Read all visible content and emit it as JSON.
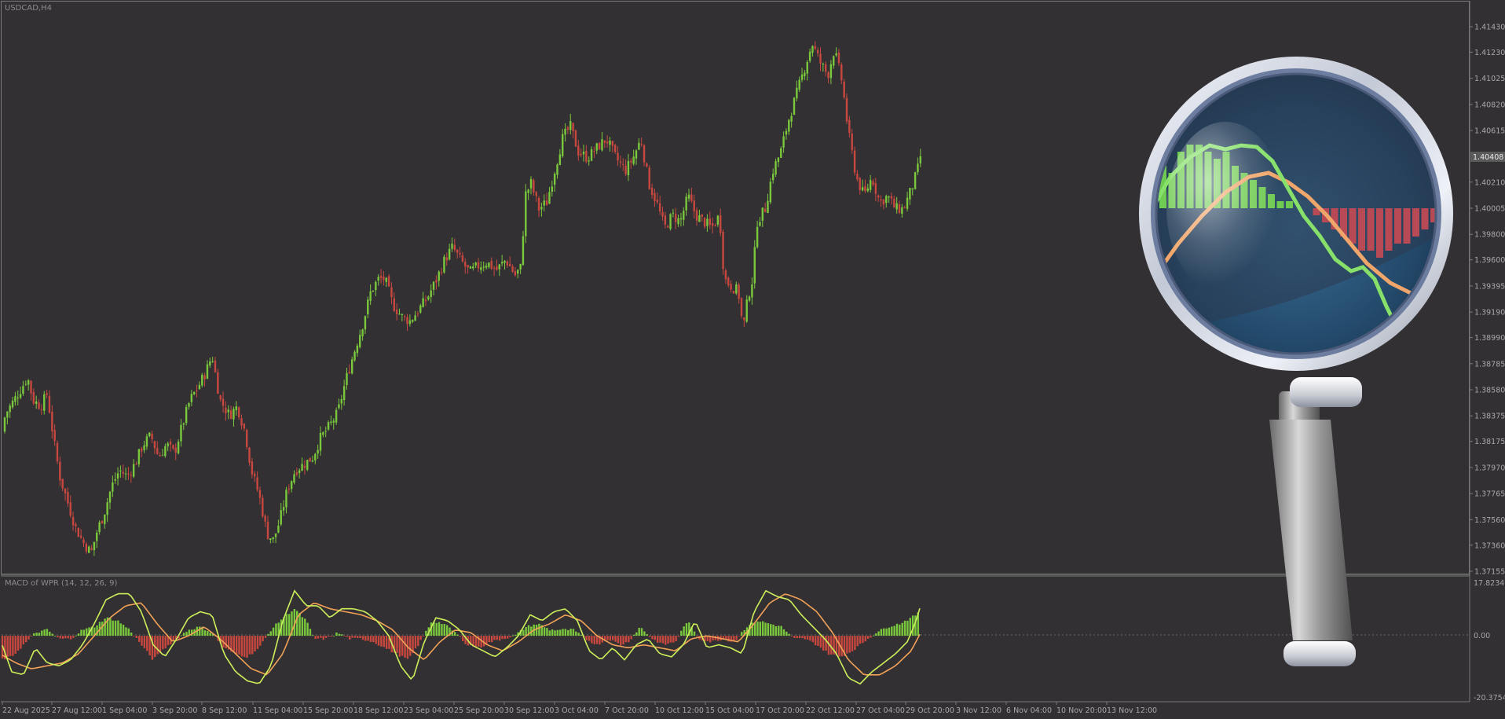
{
  "window": {
    "symbol_title": "USDCAD,H4",
    "indicator_title": "MACD of WPR (14, 12, 26, 9)"
  },
  "colors": {
    "background": "#333033",
    "bull": "#7ac93c",
    "bear": "#c8483f",
    "macd_line": "#cdf05a",
    "signal_line": "#f2a257",
    "grid": "#5c5c5c",
    "magnifier_lens": "#2d5878"
  },
  "price_axis": {
    "ticks": [
      "1.41430",
      "1.41230",
      "1.41025",
      "1.40820",
      "1.40615",
      "1.40210",
      "1.40005",
      "1.39800",
      "1.39600",
      "1.39395",
      "1.39190",
      "1.38990",
      "1.38785",
      "1.38580",
      "1.38375",
      "1.38175",
      "1.37970",
      "1.37765",
      "1.37560",
      "1.37360",
      "1.37155"
    ],
    "current_price": "1.40408",
    "ylim": [
      1.37155,
      1.4153
    ]
  },
  "indicator_axis": {
    "top": "17.8234",
    "zero": "0.00",
    "bottom": "-20.3754"
  },
  "time_axis": {
    "labels": [
      "22 Aug 2025",
      "27 Aug 12:00",
      "1 Sep 04:00",
      "3 Sep 20:00",
      "8 Sep 12:00",
      "11 Sep 04:00",
      "15 Sep 20:00",
      "18 Sep 12:00",
      "23 Sep 04:00",
      "25 Sep 20:00",
      "30 Sep 12:00",
      "3 Oct 04:00",
      "7 Oct 20:00",
      "10 Oct 12:00",
      "15 Oct 04:00",
      "17 Oct 20:00",
      "22 Oct 12:00",
      "27 Oct 04:00",
      "29 Oct 20:00",
      "3 Nov 12:00",
      "6 Nov 04:00",
      "10 Nov 20:00",
      "13 Nov 12:00"
    ]
  },
  "chart_data": {
    "type": "candlestick",
    "symbol": "USDCAD",
    "timeframe": "H4",
    "price_path": [
      [
        0,
        1.3825
      ],
      [
        8,
        1.384
      ],
      [
        18,
        1.385
      ],
      [
        28,
        1.386
      ],
      [
        35,
        1.3868
      ],
      [
        42,
        1.385
      ],
      [
        52,
        1.3845
      ],
      [
        60,
        1.3855
      ],
      [
        68,
        1.382
      ],
      [
        76,
        1.379
      ],
      [
        86,
        1.377
      ],
      [
        96,
        1.375
      ],
      [
        106,
        1.3738
      ],
      [
        116,
        1.373
      ],
      [
        124,
        1.3748
      ],
      [
        132,
        1.376
      ],
      [
        142,
        1.3782
      ],
      [
        152,
        1.3795
      ],
      [
        162,
        1.379
      ],
      [
        172,
        1.38
      ],
      [
        182,
        1.3815
      ],
      [
        192,
        1.3822
      ],
      [
        202,
        1.3805
      ],
      [
        212,
        1.3815
      ],
      [
        222,
        1.3808
      ],
      [
        232,
        1.383
      ],
      [
        242,
        1.385
      ],
      [
        252,
        1.386
      ],
      [
        262,
        1.3872
      ],
      [
        270,
        1.3885
      ],
      [
        280,
        1.385
      ],
      [
        292,
        1.3838
      ],
      [
        302,
        1.3845
      ],
      [
        312,
        1.3825
      ],
      [
        320,
        1.3795
      ],
      [
        330,
        1.3775
      ],
      [
        340,
        1.3745
      ],
      [
        348,
        1.374
      ],
      [
        356,
        1.3755
      ],
      [
        366,
        1.378
      ],
      [
        376,
        1.3795
      ],
      [
        388,
        1.38
      ],
      [
        398,
        1.3805
      ],
      [
        408,
        1.382
      ],
      [
        420,
        1.383
      ],
      [
        430,
        1.384
      ],
      [
        440,
        1.3865
      ],
      [
        452,
        1.389
      ],
      [
        462,
        1.391
      ],
      [
        472,
        1.3935
      ],
      [
        482,
        1.3945
      ],
      [
        490,
        1.3945
      ],
      [
        500,
        1.3925
      ],
      [
        512,
        1.3915
      ],
      [
        522,
        1.3912
      ],
      [
        532,
        1.392
      ],
      [
        544,
        1.393
      ],
      [
        556,
        1.3945
      ],
      [
        566,
        1.396
      ],
      [
        576,
        1.397
      ],
      [
        586,
        1.396
      ],
      [
        598,
        1.395
      ],
      [
        608,
        1.3955
      ],
      [
        620,
        1.3958
      ],
      [
        632,
        1.3952
      ],
      [
        644,
        1.396
      ],
      [
        656,
        1.3948
      ],
      [
        664,
        1.3955
      ],
      [
        668,
        1.401
      ],
      [
        676,
        1.402
      ],
      [
        686,
        1.4
      ],
      [
        696,
        1.4005
      ],
      [
        706,
        1.403
      ],
      [
        716,
        1.4055
      ],
      [
        726,
        1.4065
      ],
      [
        736,
        1.4045
      ],
      [
        748,
        1.404
      ],
      [
        760,
        1.4048
      ],
      [
        772,
        1.4055
      ],
      [
        784,
        1.404
      ],
      [
        796,
        1.403
      ],
      [
        806,
        1.404
      ],
      [
        816,
        1.4055
      ],
      [
        826,
        1.402
      ],
      [
        836,
        1.4005
      ],
      [
        846,
        1.3985
      ],
      [
        856,
        1.3995
      ],
      [
        866,
        1.399
      ],
      [
        876,
        1.401
      ],
      [
        886,
        1.3995
      ],
      [
        896,
        1.399
      ],
      [
        906,
        1.3985
      ],
      [
        916,
        1.3995
      ],
      [
        922,
        1.3945
      ],
      [
        930,
        1.394
      ],
      [
        940,
        1.3935
      ],
      [
        946,
        1.3905
      ],
      [
        952,
        1.393
      ],
      [
        958,
        1.3945
      ],
      [
        964,
        1.399
      ],
      [
        974,
        1.4
      ],
      [
        984,
        1.403
      ],
      [
        994,
        1.4045
      ],
      [
        1004,
        1.407
      ],
      [
        1014,
        1.409
      ],
      [
        1024,
        1.411
      ],
      [
        1034,
        1.413
      ],
      [
        1044,
        1.4115
      ],
      [
        1054,
        1.4105
      ],
      [
        1062,
        1.4125
      ],
      [
        1072,
        1.41
      ],
      [
        1080,
        1.406
      ],
      [
        1090,
        1.4025
      ],
      [
        1100,
        1.401
      ],
      [
        1110,
        1.4025
      ],
      [
        1120,
        1.4005
      ],
      [
        1130,
        1.401
      ],
      [
        1140,
        1.4
      ],
      [
        1150,
        1.4
      ],
      [
        1160,
        1.4015
      ],
      [
        1168,
        1.403
      ],
      [
        1172,
        1.4042
      ]
    ],
    "indicator": {
      "name": "MACD of WPR (14, 12, 26, 9)",
      "histogram_path": [
        [
          0,
          -8
        ],
        [
          15,
          -7
        ],
        [
          30,
          -3
        ],
        [
          45,
          1
        ],
        [
          60,
          2
        ],
        [
          75,
          -1
        ],
        [
          90,
          -1
        ],
        [
          105,
          2
        ],
        [
          120,
          3
        ],
        [
          135,
          6
        ],
        [
          150,
          5
        ],
        [
          165,
          2
        ],
        [
          180,
          -3
        ],
        [
          195,
          -8
        ],
        [
          210,
          -4
        ],
        [
          225,
          -1
        ],
        [
          240,
          2
        ],
        [
          255,
          3
        ],
        [
          270,
          1
        ],
        [
          285,
          -4
        ],
        [
          300,
          -6
        ],
        [
          315,
          -7
        ],
        [
          330,
          -4
        ],
        [
          345,
          2
        ],
        [
          360,
          6
        ],
        [
          375,
          9
        ],
        [
          390,
          5
        ],
        [
          400,
          -1
        ],
        [
          415,
          -1
        ],
        [
          430,
          1
        ],
        [
          445,
          -1
        ],
        [
          460,
          -1
        ],
        [
          475,
          -2
        ],
        [
          490,
          -4
        ],
        [
          505,
          -6
        ],
        [
          520,
          -8
        ],
        [
          535,
          -2
        ],
        [
          550,
          5
        ],
        [
          565,
          4
        ],
        [
          580,
          1
        ],
        [
          595,
          -3
        ],
        [
          610,
          -4
        ],
        [
          625,
          -2
        ],
        [
          640,
          -1
        ],
        [
          655,
          0
        ],
        [
          670,
          3
        ],
        [
          685,
          4
        ],
        [
          700,
          2
        ],
        [
          715,
          2
        ],
        [
          730,
          2
        ],
        [
          745,
          -1
        ],
        [
          760,
          -3
        ],
        [
          775,
          -1
        ],
        [
          790,
          -3
        ],
        [
          800,
          -2
        ],
        [
          815,
          3
        ],
        [
          830,
          -1
        ],
        [
          845,
          -3
        ],
        [
          860,
          -2
        ],
        [
          875,
          5
        ],
        [
          890,
          -1
        ],
        [
          905,
          -2
        ],
        [
          920,
          -1
        ],
        [
          935,
          -2
        ],
        [
          950,
          3
        ],
        [
          965,
          5
        ],
        [
          980,
          4
        ],
        [
          995,
          3
        ],
        [
          1010,
          -1
        ],
        [
          1025,
          -1
        ],
        [
          1040,
          -3
        ],
        [
          1055,
          -6
        ],
        [
          1070,
          -7
        ],
        [
          1085,
          -5
        ],
        [
          1100,
          -2
        ],
        [
          1115,
          1
        ],
        [
          1130,
          3
        ],
        [
          1145,
          4
        ],
        [
          1160,
          6
        ],
        [
          1172,
          8
        ]
      ],
      "macd_path": [
        [
          0,
          -1
        ],
        [
          15,
          -12
        ],
        [
          30,
          -13
        ],
        [
          45,
          -4
        ],
        [
          60,
          -9
        ],
        [
          75,
          -10
        ],
        [
          90,
          -8
        ],
        [
          105,
          -3
        ],
        [
          120,
          4
        ],
        [
          135,
          12
        ],
        [
          150,
          14
        ],
        [
          165,
          14
        ],
        [
          180,
          8
        ],
        [
          195,
          -3
        ],
        [
          210,
          -7
        ],
        [
          225,
          -1
        ],
        [
          240,
          6
        ],
        [
          255,
          8
        ],
        [
          270,
          7
        ],
        [
          285,
          -6
        ],
        [
          300,
          -12
        ],
        [
          315,
          -15
        ],
        [
          330,
          -16
        ],
        [
          345,
          -10
        ],
        [
          360,
          5
        ],
        [
          375,
          15
        ],
        [
          390,
          10
        ],
        [
          405,
          10
        ],
        [
          420,
          6
        ],
        [
          435,
          9
        ],
        [
          450,
          9
        ],
        [
          465,
          8
        ],
        [
          480,
          5
        ],
        [
          495,
          0
        ],
        [
          510,
          -10
        ],
        [
          525,
          -15
        ],
        [
          540,
          -2
        ],
        [
          555,
          6
        ],
        [
          570,
          5
        ],
        [
          585,
          2
        ],
        [
          600,
          -3
        ],
        [
          615,
          -5
        ],
        [
          630,
          -7
        ],
        [
          645,
          -4
        ],
        [
          660,
          0
        ],
        [
          675,
          7
        ],
        [
          690,
          5
        ],
        [
          705,
          8
        ],
        [
          720,
          9
        ],
        [
          735,
          5
        ],
        [
          750,
          -5
        ],
        [
          765,
          -8
        ],
        [
          780,
          -4
        ],
        [
          795,
          -8
        ],
        [
          810,
          -3
        ],
        [
          825,
          -1
        ],
        [
          840,
          -6
        ],
        [
          855,
          -7
        ],
        [
          870,
          -3
        ],
        [
          885,
          5
        ],
        [
          900,
          -4
        ],
        [
          915,
          -3
        ],
        [
          930,
          -4
        ],
        [
          945,
          -6
        ],
        [
          960,
          8
        ],
        [
          975,
          15
        ],
        [
          990,
          13
        ],
        [
          1005,
          12
        ],
        [
          1020,
          7
        ],
        [
          1035,
          3
        ],
        [
          1050,
          -1
        ],
        [
          1065,
          -6
        ],
        [
          1080,
          -14
        ],
        [
          1095,
          -16
        ],
        [
          1110,
          -12
        ],
        [
          1125,
          -9
        ],
        [
          1140,
          -6
        ],
        [
          1155,
          -2
        ],
        [
          1165,
          4
        ],
        [
          1172,
          10
        ]
      ],
      "signal_path": [
        [
          0,
          -6
        ],
        [
          20,
          -9
        ],
        [
          40,
          -11
        ],
        [
          60,
          -10
        ],
        [
          80,
          -9
        ],
        [
          100,
          -6
        ],
        [
          120,
          0
        ],
        [
          140,
          6
        ],
        [
          160,
          10
        ],
        [
          180,
          11
        ],
        [
          200,
          4
        ],
        [
          220,
          -2
        ],
        [
          240,
          0
        ],
        [
          260,
          3
        ],
        [
          280,
          -1
        ],
        [
          300,
          -6
        ],
        [
          320,
          -11
        ],
        [
          340,
          -13
        ],
        [
          360,
          -6
        ],
        [
          380,
          7
        ],
        [
          400,
          11
        ],
        [
          420,
          9
        ],
        [
          440,
          8
        ],
        [
          460,
          7
        ],
        [
          480,
          5
        ],
        [
          500,
          2
        ],
        [
          520,
          -4
        ],
        [
          540,
          -8
        ],
        [
          560,
          -2
        ],
        [
          580,
          2
        ],
        [
          600,
          1
        ],
        [
          620,
          -3
        ],
        [
          640,
          -5
        ],
        [
          660,
          -2
        ],
        [
          680,
          2
        ],
        [
          700,
          4
        ],
        [
          720,
          7
        ],
        [
          740,
          5
        ],
        [
          760,
          0
        ],
        [
          780,
          -3
        ],
        [
          800,
          -4
        ],
        [
          820,
          -3
        ],
        [
          840,
          -4
        ],
        [
          860,
          -5
        ],
        [
          880,
          -1
        ],
        [
          900,
          0
        ],
        [
          920,
          -1
        ],
        [
          940,
          -2
        ],
        [
          960,
          4
        ],
        [
          980,
          11
        ],
        [
          1000,
          14
        ],
        [
          1020,
          12
        ],
        [
          1040,
          8
        ],
        [
          1060,
          1
        ],
        [
          1080,
          -8
        ],
        [
          1100,
          -13
        ],
        [
          1120,
          -13
        ],
        [
          1140,
          -10
        ],
        [
          1160,
          -5
        ],
        [
          1172,
          1
        ]
      ]
    }
  }
}
